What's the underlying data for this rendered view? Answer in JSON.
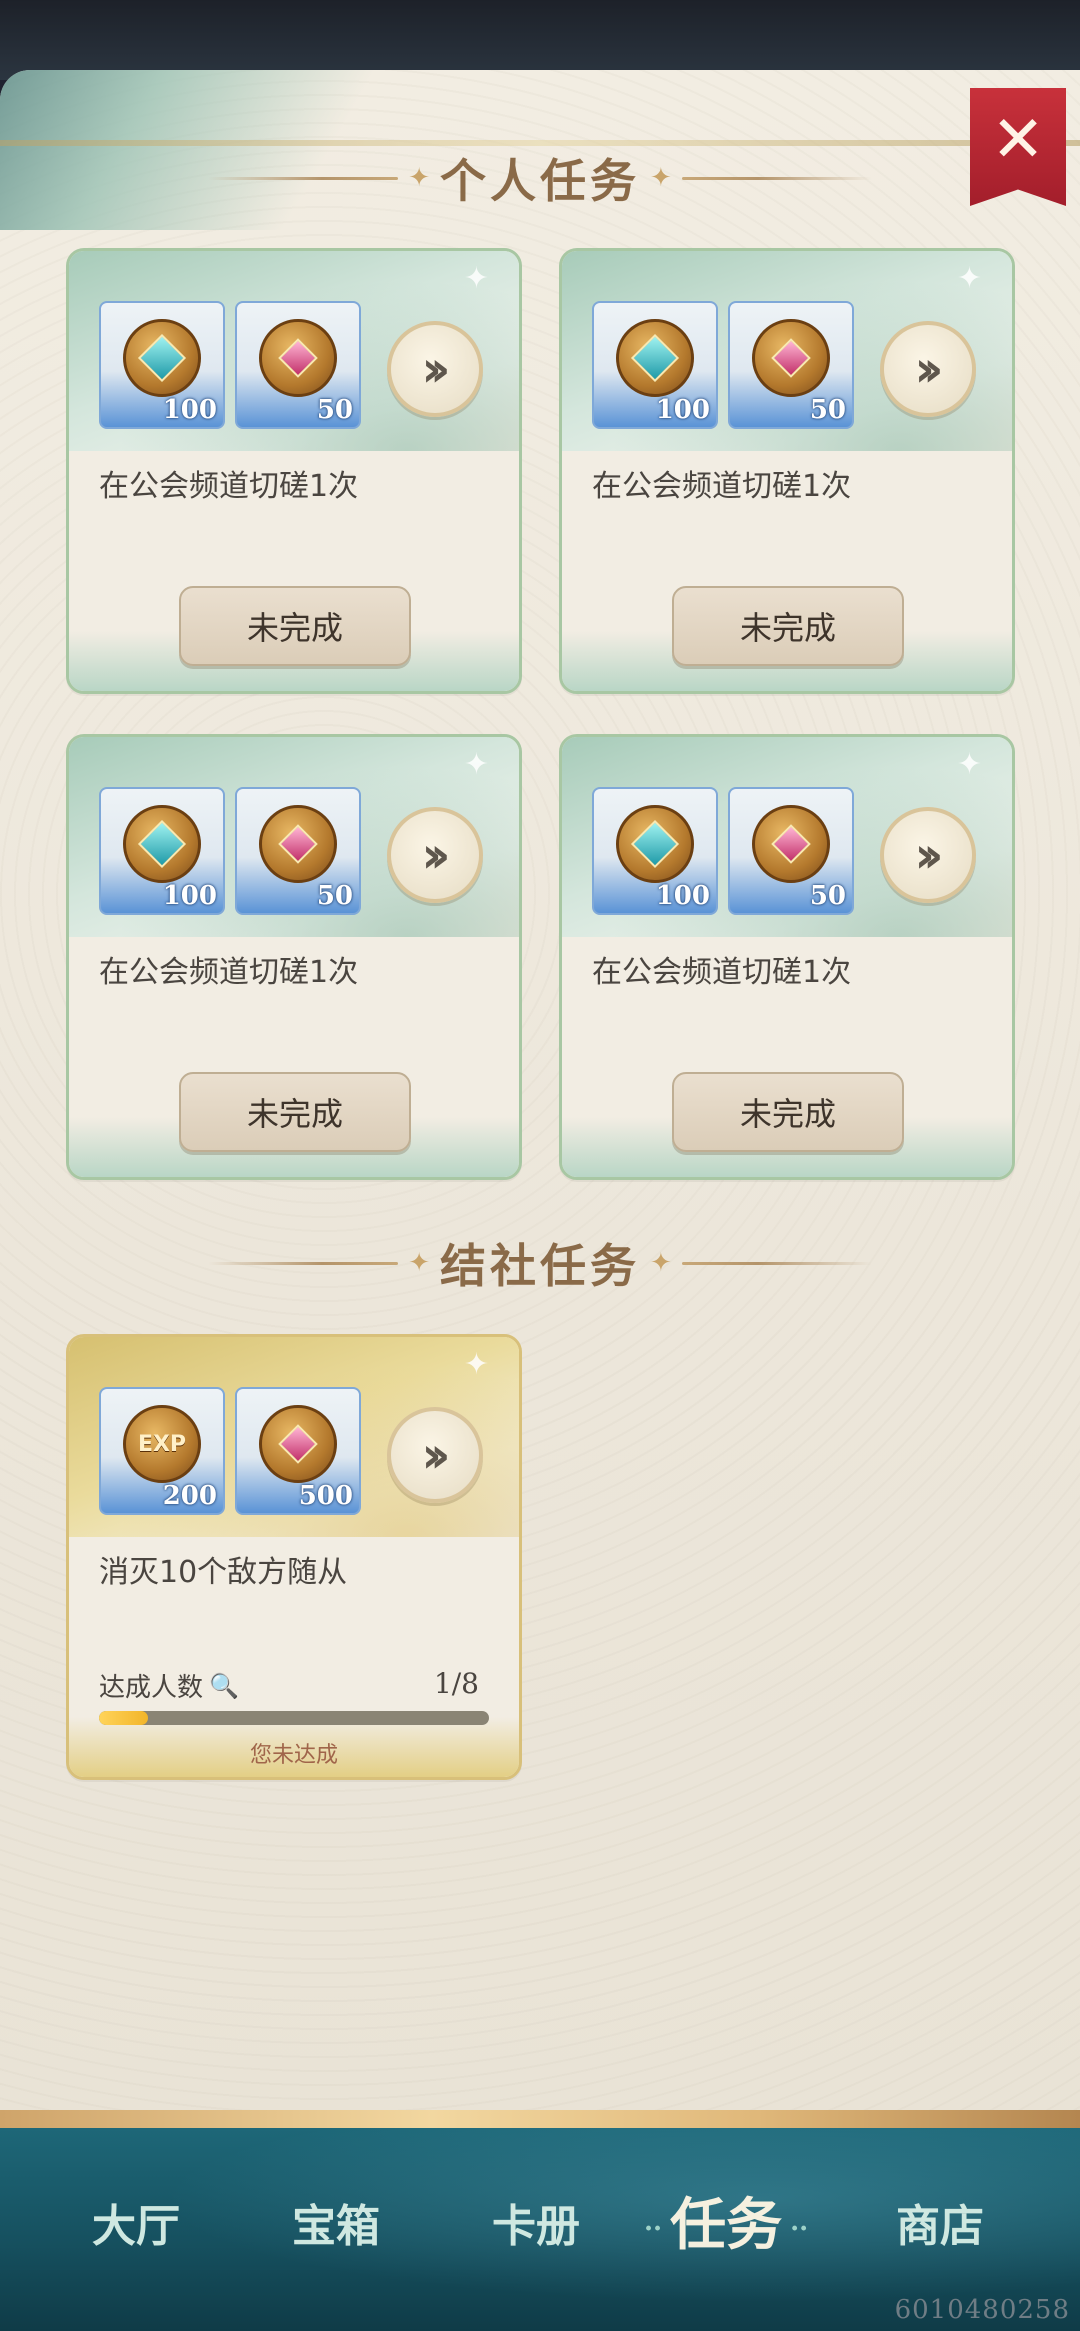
{
  "personal_section": {
    "title": "个人任务"
  },
  "guild_section": {
    "title": "结社任务"
  },
  "personal_tasks": [
    {
      "description": "在公会频道切磋1次",
      "rewards": [
        {
          "icon": "coin-teal-gem-icon",
          "qty": "100"
        },
        {
          "icon": "coin-chest-icon",
          "qty": "50"
        }
      ],
      "status": "未完成"
    },
    {
      "description": "在公会频道切磋1次",
      "rewards": [
        {
          "icon": "coin-teal-gem-icon",
          "qty": "100"
        },
        {
          "icon": "coin-chest-icon",
          "qty": "50"
        }
      ],
      "status": "未完成"
    },
    {
      "description": "在公会频道切磋1次",
      "rewards": [
        {
          "icon": "coin-teal-gem-icon",
          "qty": "100"
        },
        {
          "icon": "coin-chest-icon",
          "qty": "50"
        }
      ],
      "status": "未完成"
    },
    {
      "description": "在公会频道切磋1次",
      "rewards": [
        {
          "icon": "coin-teal-gem-icon",
          "qty": "100"
        },
        {
          "icon": "coin-chest-icon",
          "qty": "50"
        }
      ],
      "status": "未完成"
    }
  ],
  "guild_task": {
    "description": "消灭10个敌方随从",
    "rewards": [
      {
        "icon": "exp-coin-icon",
        "label": "EXP",
        "qty": "200"
      },
      {
        "icon": "coin-chest-icon",
        "qty": "500"
      }
    ],
    "progress_label": "达成人数",
    "progress_count": "1/8",
    "progress_fraction": 0.125,
    "progress_note": "您未达成"
  },
  "nav": {
    "items": [
      "大厅",
      "宝箱",
      "卡册",
      "任务",
      "商店"
    ],
    "active": "任务"
  },
  "build_id": "6010480258",
  "colors": {
    "card_border_green": "#a8c7a3",
    "card_border_gold": "#d8c07a",
    "close_red": "#b7252f",
    "nav_teal": "#1f6b7c",
    "progress_fill": "#f2b429"
  }
}
